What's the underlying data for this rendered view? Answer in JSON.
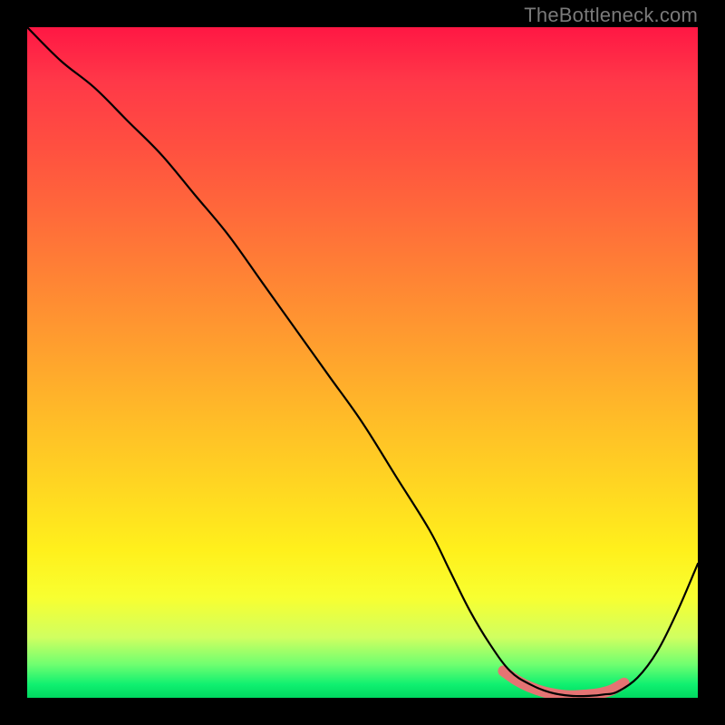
{
  "watermark": "TheBottleneck.com",
  "chart_data": {
    "type": "line",
    "title": "",
    "xlabel": "",
    "ylabel": "",
    "xlim": [
      0,
      100
    ],
    "ylim": [
      0,
      100
    ],
    "grid": false,
    "series": [
      {
        "name": "bottleneck-curve",
        "color": "#000000",
        "x": [
          0,
          5,
          10,
          15,
          20,
          25,
          30,
          35,
          40,
          45,
          50,
          55,
          60,
          63,
          66,
          69,
          72,
          75,
          78,
          81,
          84,
          86,
          88,
          91,
          94,
          97,
          100
        ],
        "values": [
          100,
          95,
          91,
          86,
          81,
          75,
          69,
          62,
          55,
          48,
          41,
          33,
          25,
          19,
          13,
          8,
          4,
          2,
          0.8,
          0.3,
          0.3,
          0.5,
          0.9,
          3,
          7,
          13,
          20
        ]
      },
      {
        "name": "optimal-zone-highlight",
        "color": "#e57373",
        "x": [
          71,
          73,
          75,
          77,
          79,
          81,
          83,
          85,
          87,
          89
        ],
        "values": [
          4,
          2.6,
          1.6,
          0.9,
          0.5,
          0.3,
          0.4,
          0.6,
          1.1,
          2.2
        ]
      }
    ]
  }
}
